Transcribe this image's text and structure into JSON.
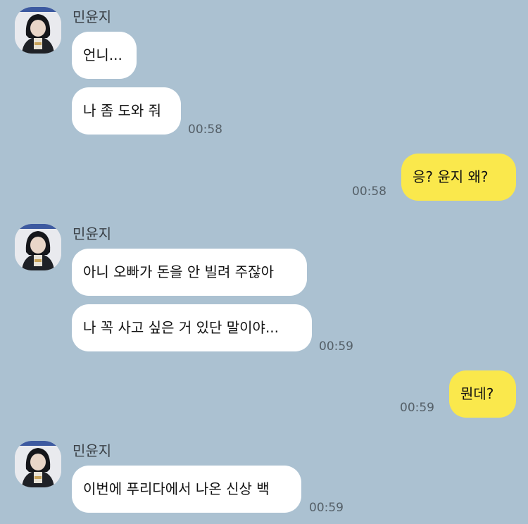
{
  "colors": {
    "background": "#abc1d1",
    "incoming_bubble": "#ffffff",
    "outgoing_bubble": "#fae84c"
  },
  "messages": {
    "g1": {
      "sender": "민윤지",
      "m1": "언니...",
      "m2": "나 좀 도와 줘",
      "time": "00:58"
    },
    "o1": {
      "text": "응? 윤지 왜?",
      "time": "00:58"
    },
    "g2": {
      "sender": "민윤지",
      "m1": "아니 오빠가 돈을 안 빌려 주잖아",
      "m2": "나 꼭 사고 싶은 거 있단 말이야...",
      "time": "00:59"
    },
    "o2": {
      "text": "뭔데?",
      "time": "00:59"
    },
    "g3": {
      "sender": "민윤지",
      "m1": "이번에 푸리다에서 나온 신상 백",
      "time": "00:59"
    }
  },
  "icons": {
    "avatar": "profile-photo-avatar"
  }
}
